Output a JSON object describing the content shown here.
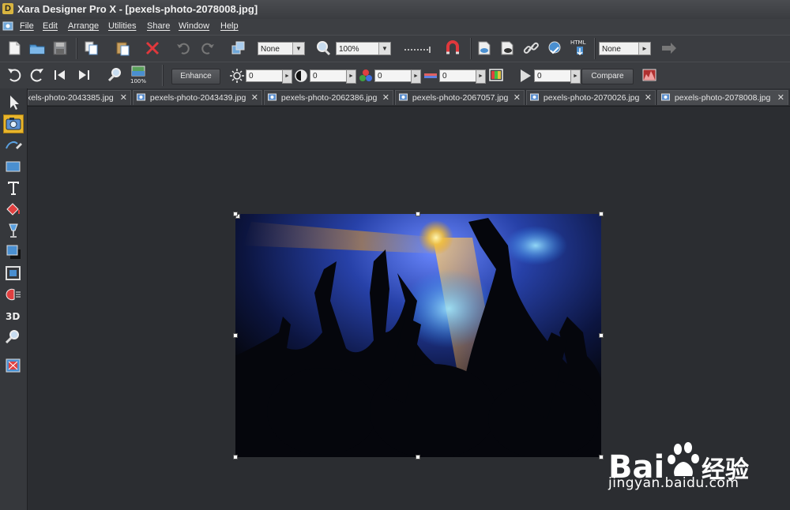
{
  "window": {
    "title": "Xara Designer Pro X - [pexels-photo-2078008.jpg]"
  },
  "menu": [
    "File",
    "Edit",
    "Arrange",
    "Utilities",
    "Share",
    "Window",
    "Help"
  ],
  "toolbar1": {
    "combo_left": "None",
    "zoom": "100%",
    "combo_right": "None",
    "html_label": "HTML"
  },
  "toolbar2": {
    "enhance_label": "Enhance",
    "brightness": "0",
    "contrast": "0",
    "saturation": "0",
    "temperature": "0",
    "sharpness": "0",
    "compare_label": "Compare",
    "zoom_label": "100%"
  },
  "tabs": [
    "xels-photo-2043385.jpg",
    "pexels-photo-2043439.jpg",
    "pexels-photo-2062386.jpg",
    "pexels-photo-2067057.jpg",
    "pexels-photo-2070026.jpg",
    "pexels-photo-2078008.jpg"
  ],
  "tools": [
    "selector-tool",
    "photo-tool",
    "freehand-tool",
    "rectangle-tool",
    "text-tool",
    "fill-tool",
    "transparency-tool",
    "shadow-tool",
    "contour-tool",
    "mould-tool",
    "3d-tool",
    "zoom-tool",
    "live-effects-tool"
  ],
  "watermark": {
    "brand": "Bai",
    "brand_cn": "经验",
    "url": "jingyan.baidu.com"
  },
  "colors": {
    "accent": "#e8b52c",
    "canvas": "#2b2d31",
    "toolbar": "#3b3d41"
  }
}
